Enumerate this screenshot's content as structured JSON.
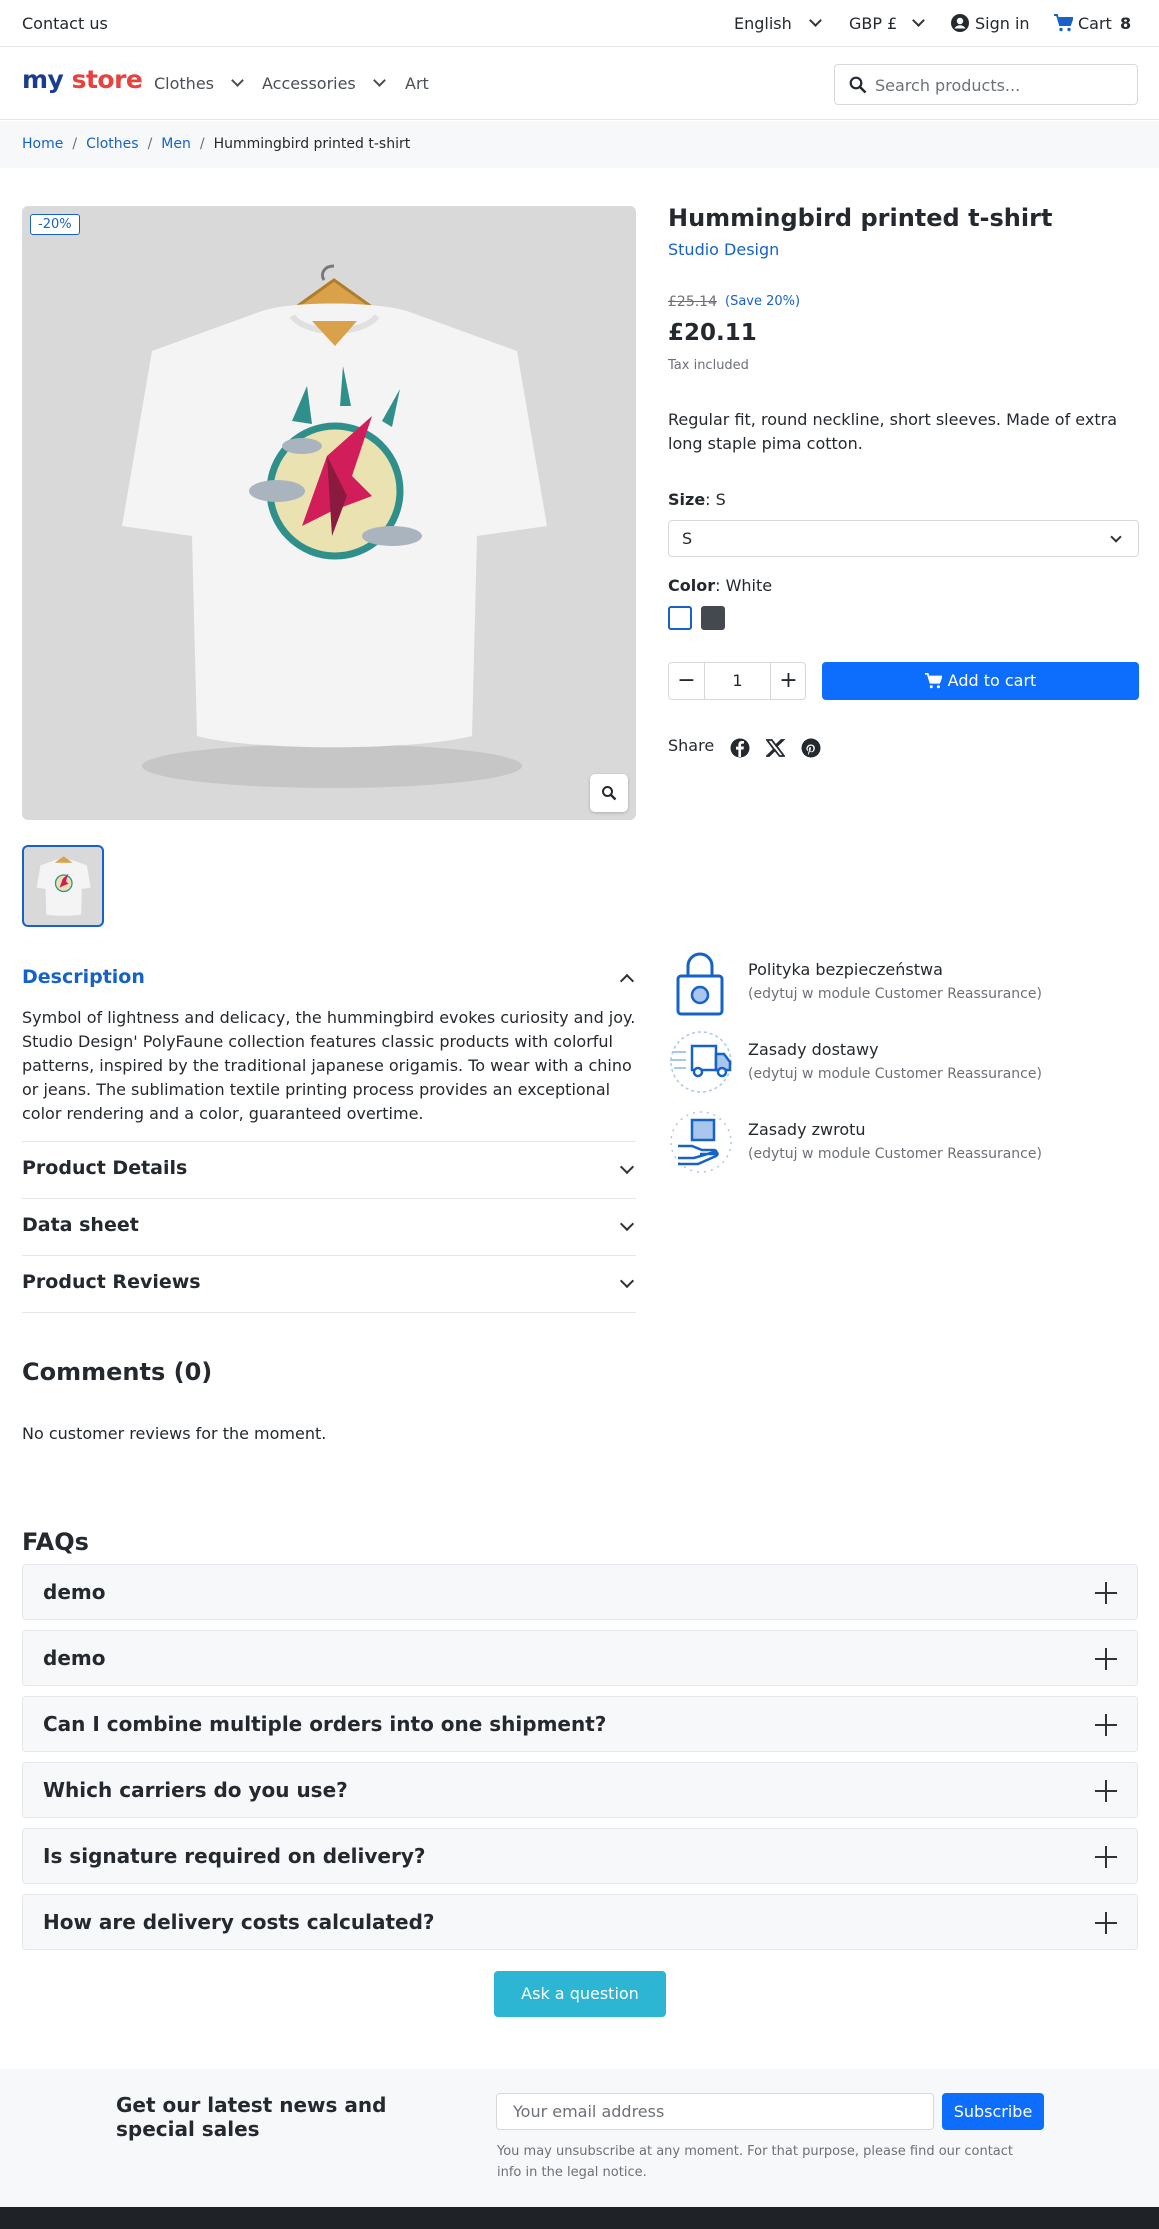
{
  "topbar": {
    "contact": "Contact us",
    "language": "English",
    "currency": "GBP £",
    "sign_in": "Sign in",
    "cart_label": "Cart",
    "cart_count": "8"
  },
  "header": {
    "logo_my": "my",
    "logo_store": "store",
    "nav": [
      "Clothes",
      "Accessories",
      "Art"
    ],
    "search_placeholder": "Search products..."
  },
  "breadcrumb": [
    "Home",
    "Clothes",
    "Men",
    "Hummingbird printed t-shirt"
  ],
  "product": {
    "discount_badge": "-20%",
    "title": "Hummingbird printed t-shirt",
    "brand": "Studio Design",
    "old_price": "£25.14",
    "save": "(Save 20%)",
    "price": "£20.11",
    "tax": "Tax included",
    "short_description": "Regular fit, round neckline, short sleeves. Made of extra long staple pima cotton.",
    "size_label": "Size",
    "size_value": "S",
    "size_selected": "S",
    "color_label": "Color",
    "color_value": "White",
    "color_swatches": [
      "#ffffff",
      "#43494f"
    ],
    "quantity": "1",
    "add_to_cart": "Add to cart",
    "share_label": "Share"
  },
  "tabs": {
    "description": {
      "title": "Description",
      "text": "Symbol of lightness and delicacy, the hummingbird evokes curiosity and joy. Studio Design' PolyFaune collection features classic products with colorful patterns, inspired by the traditional japanese origamis. To wear with a chino or jeans. The sublimation textile printing process provides an exceptional color rendering and a color, guaranteed overtime."
    },
    "product_details": "Product Details",
    "data_sheet": "Data sheet",
    "product_reviews": "Product Reviews"
  },
  "reassurance": [
    {
      "title": "Polityka bezpieczeństwa",
      "sub": "(edytuj w module Customer Reassurance)",
      "icon": "lock-icon"
    },
    {
      "title": "Zasady dostawy",
      "sub": "(edytuj w module Customer Reassurance)",
      "icon": "delivery-truck-icon"
    },
    {
      "title": "Zasady zwrotu",
      "sub": "(edytuj w module Customer Reassurance)",
      "icon": "return-package-icon"
    }
  ],
  "comments": {
    "title": "Comments (0)",
    "empty": "No customer reviews for the moment."
  },
  "faq": {
    "title": "FAQs",
    "items": [
      "demo",
      "demo",
      "Can I combine multiple orders into one shipment?",
      "Which carriers do you use?",
      "Is signature required on delivery?",
      "How are delivery costs calculated?"
    ],
    "ask_button": "Ask a question"
  },
  "newsletter": {
    "title": "Get our latest news and special sales",
    "placeholder": "Your email address",
    "subscribe": "Subscribe",
    "note": "You may unsubscribe at any moment. For that purpose, please find our contact info in the legal notice."
  },
  "colors": {
    "primary": "#0d6efd",
    "link": "#1762c6",
    "ask_button": "#2db5d4"
  }
}
